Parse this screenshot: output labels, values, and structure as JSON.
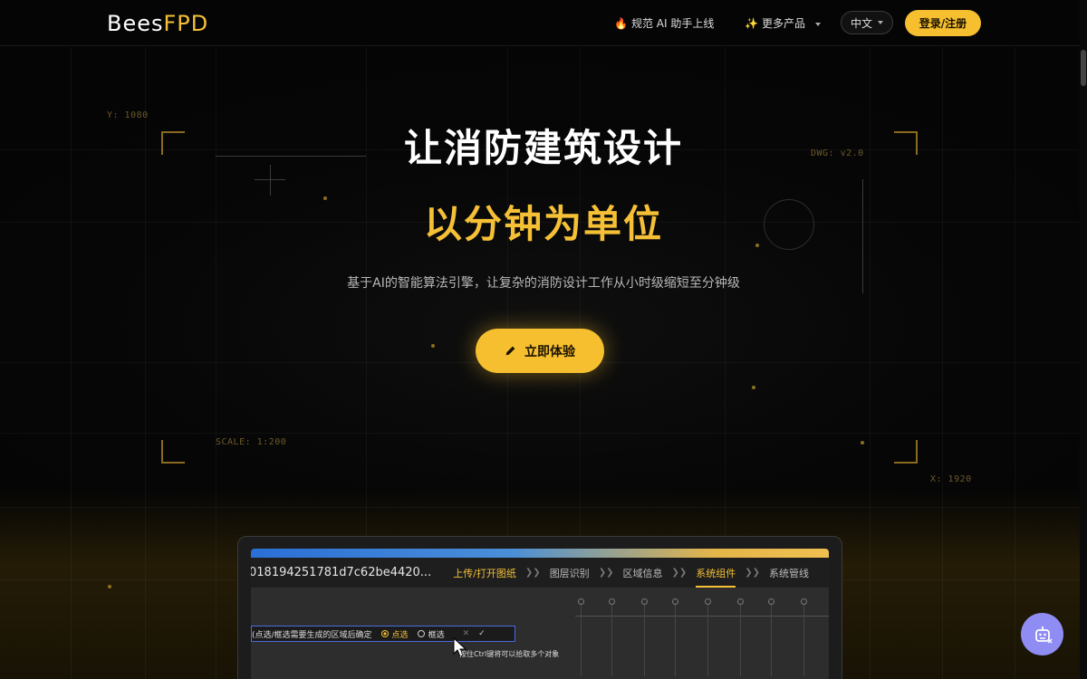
{
  "header": {
    "logo_part1": "Bees",
    "logo_part2": "FPD",
    "announcement_icon": "🔥",
    "announcement": "规范 AI 助手上线",
    "products_icon": "✨",
    "products": "更多产品",
    "language": "中文",
    "login": "登录/注册"
  },
  "hero": {
    "title_line1": "让消防建筑设计",
    "title_line2": "以分钟为单位",
    "subtitle": "基于AI的智能算法引擎，让复杂的消防设计工作从小时级缩短至分钟级",
    "cta": "立即体验"
  },
  "cad_labels": {
    "y": "Y: 1080",
    "dwg": "DWG: v2.0",
    "scale": "SCALE: 1:200",
    "x": "X: 1920"
  },
  "preview": {
    "filename": "018194251781d7c62be4420...",
    "steps": [
      "上传/打开图纸",
      "图层识别",
      "区域信息",
      "系统组件",
      "系统管线"
    ],
    "select_prompt": "(点选/框选需要生成的区域后确定",
    "option_point": "点选",
    "option_box": "框选",
    "hint": "按住Ctrl键将可以拾取多个对象"
  },
  "colors": {
    "accent": "#f5c036",
    "background": "#050505",
    "chat": "#8f8df4"
  },
  "icons": {
    "cta": "pencil-icon",
    "chat": "robot-chat-icon"
  }
}
